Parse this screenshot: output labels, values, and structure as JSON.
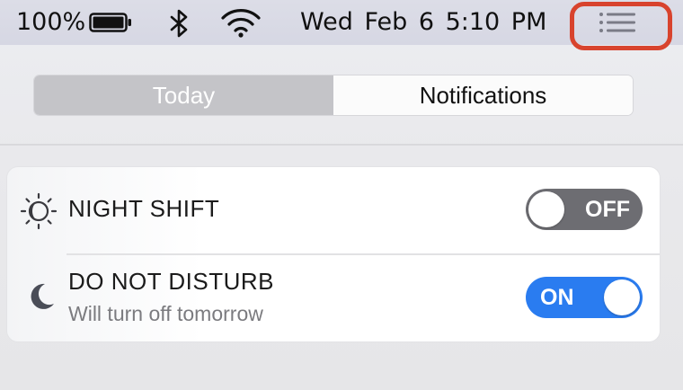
{
  "menubar": {
    "battery_percent": "100%",
    "datetime": "Wed Feb 6  5:10 PM",
    "icons": [
      "battery-icon",
      "bluetooth-icon",
      "wifi-icon",
      "notification-center-icon"
    ]
  },
  "tabs": [
    {
      "label": "Today",
      "selected": true
    },
    {
      "label": "Notifications",
      "selected": false
    }
  ],
  "widgets": {
    "night_shift": {
      "title": "NIGHT SHIFT",
      "state": "OFF",
      "icon": "night-shift-icon"
    },
    "do_not_disturb": {
      "title": "DO NOT DISTURB",
      "subtitle": "Will turn off tomorrow",
      "state": "ON",
      "icon": "moon-icon"
    }
  },
  "colors": {
    "highlight_ring": "#d8432d",
    "toggle_on": "#2a7cf0",
    "toggle_off": "#6d6d72"
  }
}
